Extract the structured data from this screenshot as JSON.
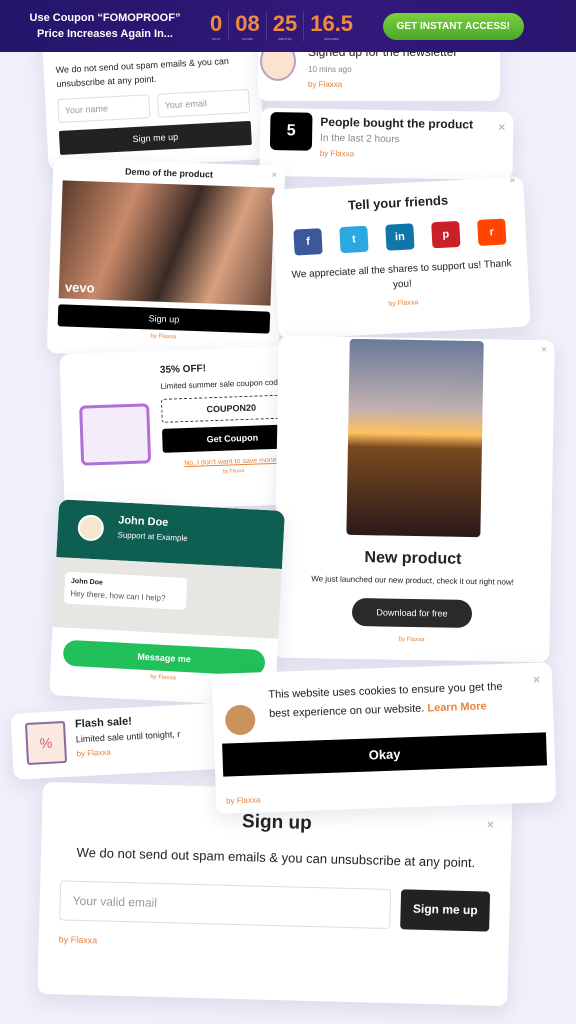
{
  "banner": {
    "line1": "Use Coupon “FOMOPROOF”",
    "line2": "Price Increases Again In...",
    "countdown": [
      {
        "value": "0",
        "unit": "DAYS"
      },
      {
        "value": "08",
        "unit": "HOURS"
      },
      {
        "value": "25",
        "unit": "MINUTES"
      },
      {
        "value": "16.5",
        "unit": "SECONDS"
      }
    ],
    "cta": "GET INSTANT ACCESS!"
  },
  "newsletter": {
    "text": "We do not send out spam emails & you can unsubscribe at any point.",
    "name_placeholder": "Your name",
    "email_placeholder": "Your email",
    "button": "Sign me up",
    "by": "by Flaxxa"
  },
  "signed": {
    "title": "Signed up for the newsletter",
    "time": "10 mins ago",
    "by": "by Flaxxa"
  },
  "bought": {
    "count": "5",
    "title": "People bought the product",
    "sub": "In the last 2 hours",
    "by": "by Flaxxa"
  },
  "demo": {
    "title": "Demo of the product",
    "logo": "vevo",
    "button": "Sign up",
    "by": "by Flaxxa"
  },
  "share": {
    "title": "Tell your friends",
    "text": "We appreciate all the shares to support us! Thank you!",
    "by": "by Flaxxa",
    "networks": [
      {
        "icon": "facebook-icon",
        "glyph": "f",
        "color": "#3b5998"
      },
      {
        "icon": "twitter-icon",
        "glyph": "t",
        "color": "#2ca7e0"
      },
      {
        "icon": "linkedin-icon",
        "glyph": "in",
        "color": "#0e76a8"
      },
      {
        "icon": "pinterest-icon",
        "glyph": "p",
        "color": "#cb2027"
      },
      {
        "icon": "reddit-icon",
        "glyph": "r",
        "color": "#ff4500"
      }
    ]
  },
  "coupon": {
    "title": "35% OFF!",
    "text": "Limited summer sale coupon code!",
    "code": "COUPON20",
    "button": "Get Coupon",
    "decline": "No, I don't want to save money!",
    "by": "by Flaxxa"
  },
  "product": {
    "title": "New product",
    "text": "We just launched our new product, check it out right now!",
    "button": "Download for free",
    "by": "by Flaxxa"
  },
  "chat": {
    "name": "John Doe",
    "role": "Support at Example",
    "msg_name": "John Doe",
    "msg": "Hey there, how can I help?",
    "button": "Message me",
    "by": "by Flaxxa",
    "color": "#0e5e52"
  },
  "flash": {
    "title": "Flash sale!",
    "text": "Limited sale until tonight, r",
    "by": "by Flaxxa"
  },
  "cookie": {
    "text": "This website uses cookies to ensure you get the best experience on our website.",
    "link": "Learn More",
    "button": "Okay",
    "by": "by Flaxxa"
  },
  "signup": {
    "title": "Sign up",
    "text": "We do not send out spam emails & you can unsubscribe at any point.",
    "placeholder": "Your valid email",
    "button": "Sign me up",
    "by": "by Flaxxa"
  }
}
